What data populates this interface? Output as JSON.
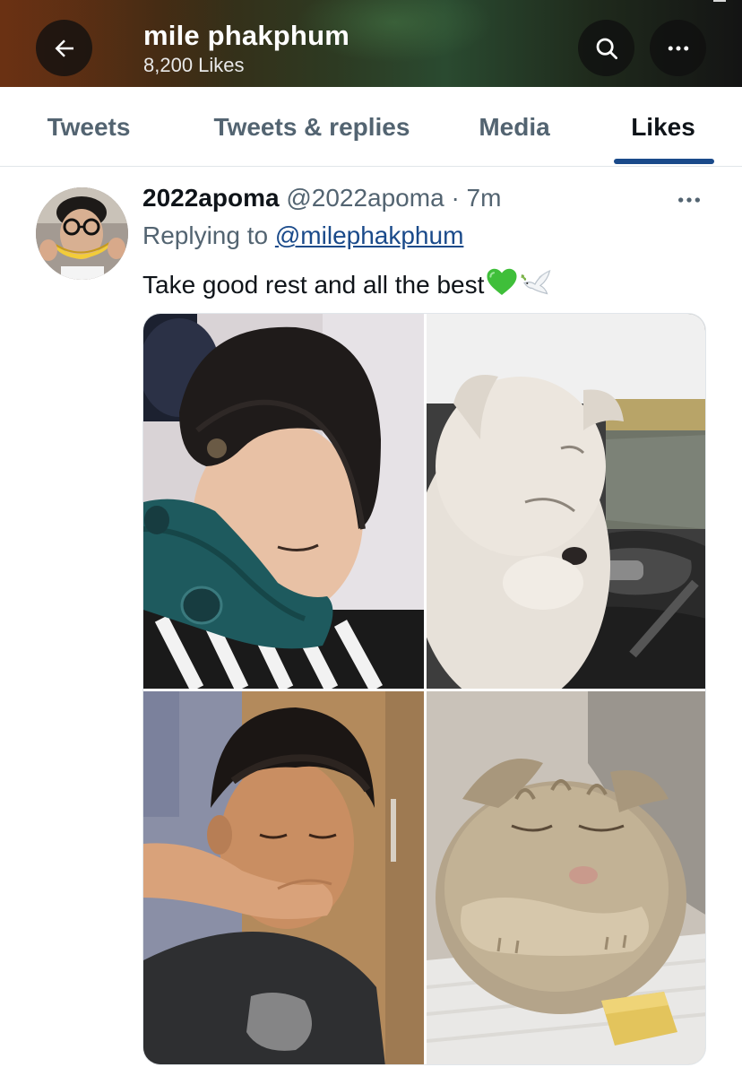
{
  "header": {
    "name": "mile phakphum",
    "likes_count": "8,200 Likes",
    "back_icon": "arrow-left-icon",
    "search_icon": "search-icon",
    "more_icon": "more-horizontal-icon"
  },
  "tabs": [
    {
      "label": "Tweets",
      "active": false
    },
    {
      "label": "Tweets & replies",
      "active": false
    },
    {
      "label": "Media",
      "active": false
    },
    {
      "label": "Likes",
      "active": true
    }
  ],
  "tweet": {
    "display_name": "2022apoma",
    "handle": "@2022apoma",
    "separator": "·",
    "time": "7m",
    "replying_prefix": "Replying to",
    "replying_to": "@milephakphum",
    "text": "Take good rest and all the best",
    "emojis": [
      "green-heart",
      "dove"
    ],
    "media": [
      {
        "alt": "person sleeping on a teal neck pillow"
      },
      {
        "alt": "white fluffy puppy asleep in a car"
      },
      {
        "alt": "person dozing with chin held by a hand"
      },
      {
        "alt": "grey scottish fold cat sleeping"
      }
    ]
  },
  "colors": {
    "accent": "#1a4a8a",
    "text_primary": "#0f1419",
    "text_secondary": "#536471",
    "divider": "#e1e6ea"
  }
}
